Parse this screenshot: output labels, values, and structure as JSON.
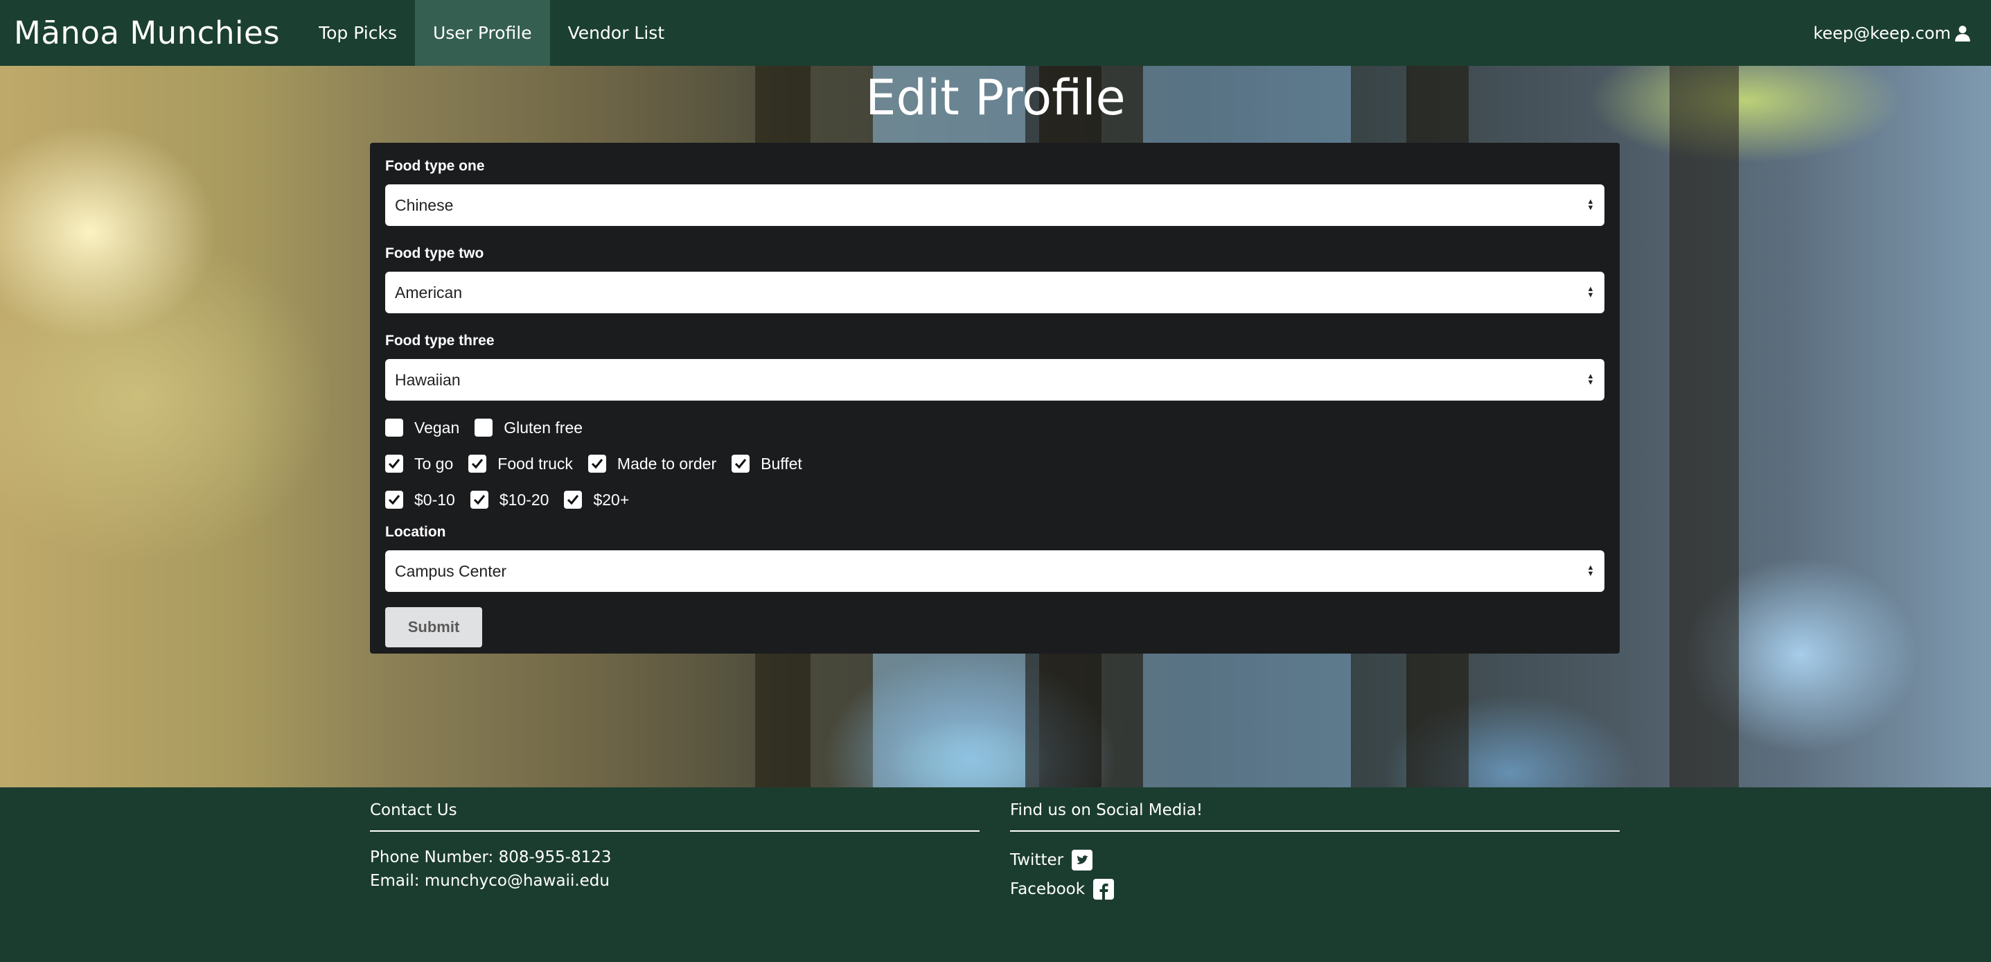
{
  "navbar": {
    "brand": "Mānoa Munchies",
    "items": [
      {
        "label": "Top Picks",
        "active": false
      },
      {
        "label": "User Profile",
        "active": true
      },
      {
        "label": "Vendor List",
        "active": false
      }
    ],
    "user_email": "keep@keep.com",
    "user_icon": "user-icon"
  },
  "page": {
    "title": "Edit Profile"
  },
  "form": {
    "food_type_one": {
      "label": "Food type one",
      "value": "Chinese"
    },
    "food_type_two": {
      "label": "Food type two",
      "value": "American"
    },
    "food_type_three": {
      "label": "Food type three",
      "value": "Hawaiian"
    },
    "diet_options": [
      {
        "label": "Vegan",
        "checked": false
      },
      {
        "label": "Gluten free",
        "checked": false
      }
    ],
    "service_options": [
      {
        "label": "To go",
        "checked": true
      },
      {
        "label": "Food truck",
        "checked": true
      },
      {
        "label": "Made to order",
        "checked": true
      },
      {
        "label": "Buffet",
        "checked": true
      }
    ],
    "price_options": [
      {
        "label": "$0-10",
        "checked": true
      },
      {
        "label": "$10-20",
        "checked": true
      },
      {
        "label": "$20+",
        "checked": true
      }
    ],
    "location": {
      "label": "Location",
      "value": "Campus Center"
    },
    "submit_label": "Submit"
  },
  "footer": {
    "contact": {
      "heading": "Contact Us",
      "phone": "Phone Number: 808-955-8123",
      "email": "Email: munchyco@hawaii.edu"
    },
    "social": {
      "heading": "Find us on Social Media!",
      "links": [
        {
          "label": "Twitter",
          "icon": "twitter-icon"
        },
        {
          "label": "Facebook",
          "icon": "facebook-icon"
        }
      ]
    }
  },
  "colors": {
    "navbar_bg": "#1b3f31",
    "nav_active_bg": "#355f50",
    "card_bg": "#1b1c1e",
    "footer_bg": "#1b3d2f",
    "button_bg": "#e0e1e2"
  }
}
